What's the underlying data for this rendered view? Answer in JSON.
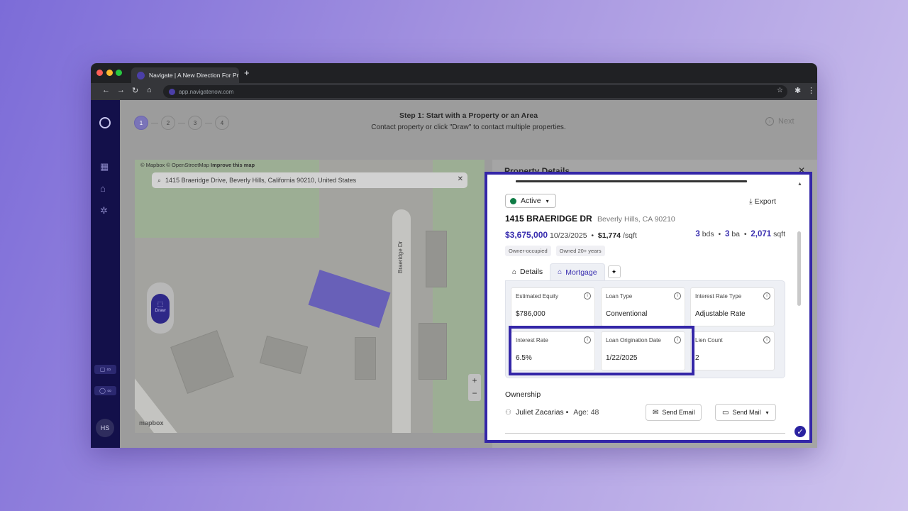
{
  "browser": {
    "tab_title": "Navigate | A New Direction For Pr",
    "new_tab": "+",
    "url": "app.navigatenow.com"
  },
  "stepper": {
    "steps": [
      "1",
      "2",
      "3",
      "4"
    ],
    "heading": "Step 1: Start with a Property or an Area",
    "subheading": "Contact property or click \"Draw\" to contact multiple properties.",
    "next_label": "Next"
  },
  "sidebar": {
    "avatar_initials": "HS"
  },
  "map": {
    "credits": "© Mapbox © OpenStreetMap",
    "improve": "Improve this map",
    "search_value": "1415 Braeridge Drive, Beverly Hills, California 90210, United States",
    "draw_label": "Draw",
    "road_label": "Braeridge Dr",
    "zoom_in": "+",
    "zoom_out": "−",
    "logo": "mapbox"
  },
  "panel": {
    "title": "Property Details",
    "status": "Active",
    "export_label": "Export",
    "street": "1415 BRAERIDGE DR",
    "city": "Beverly Hills, CA 90210",
    "price": "$3,675,000",
    "date": "10/23/2025",
    "ppsf": "$1,774",
    "ppsf_unit": "/sqft",
    "beds": "3",
    "beds_unit": "bds",
    "baths": "3",
    "baths_unit": "ba",
    "sqft": "2,071",
    "sqft_unit": "sqft",
    "tags": [
      "Owner-occupied",
      "Owned 20+ years"
    ],
    "tabs": [
      "Details",
      "Mortgage"
    ],
    "mortgage": [
      {
        "label": "Estimated Equity",
        "value": "$786,000"
      },
      {
        "label": "Loan Type",
        "value": "Conventional"
      },
      {
        "label": "Interest Rate Type",
        "value": "Adjustable Rate"
      },
      {
        "label": "Interest Rate",
        "value": "6.5%"
      },
      {
        "label": "Loan Origination Date",
        "value": "1/22/2025"
      },
      {
        "label": "Lien Count",
        "value": "2"
      }
    ],
    "ownership_title": "Ownership",
    "owner_name": "Juliet Zacarias",
    "owner_age": "Age: 48",
    "send_email": "Send Email",
    "send_mail": "Send Mail"
  },
  "colors": {
    "highlight": "#3426a8",
    "brand": "#3a2fb0",
    "active_status": "#0f7b45"
  }
}
